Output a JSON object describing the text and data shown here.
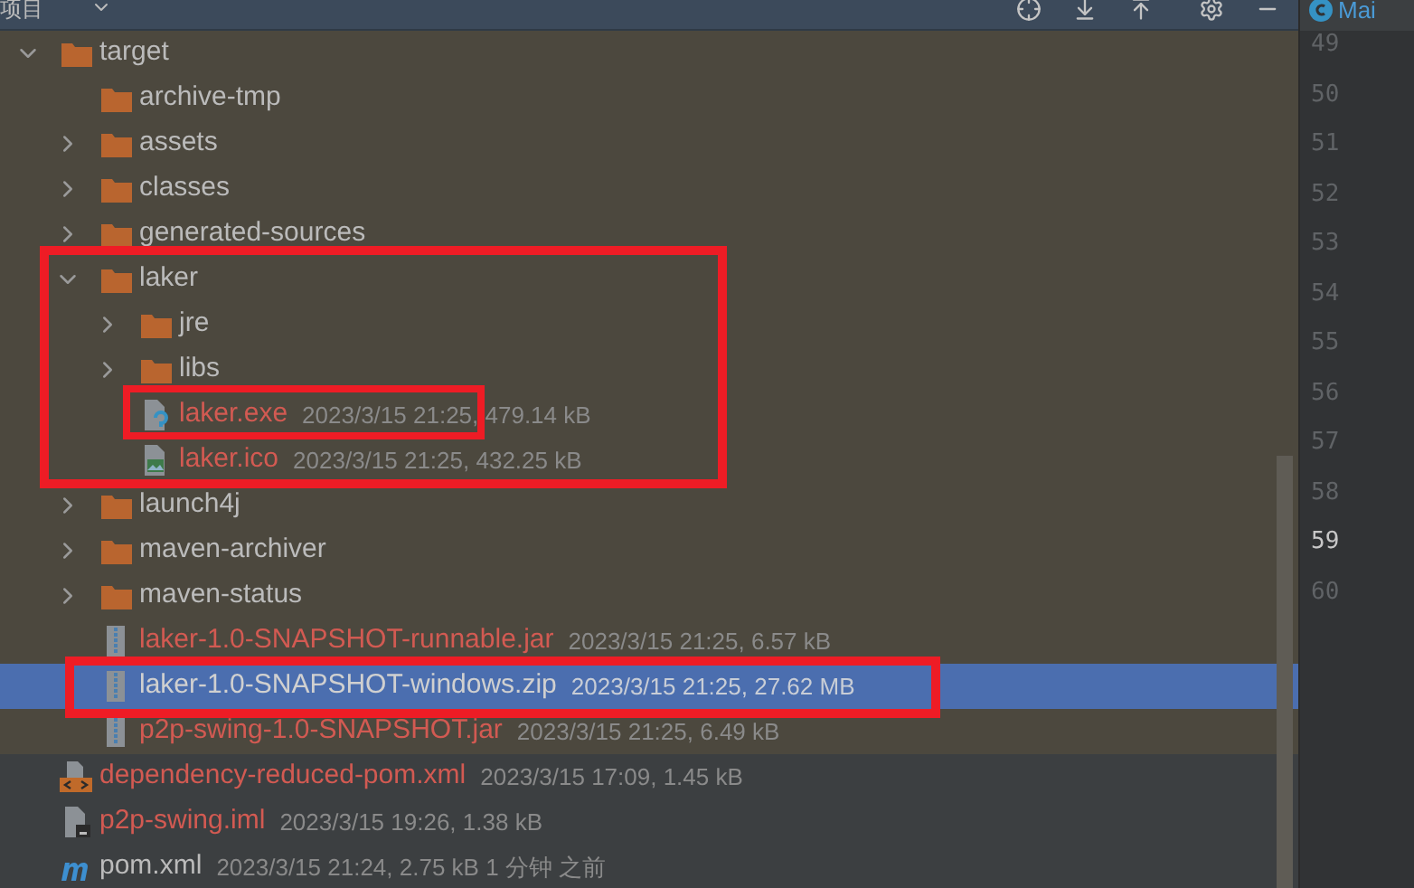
{
  "panel": {
    "title": "项目"
  },
  "tree": [
    {
      "name": "target",
      "kind": "folder",
      "expanded": true,
      "excluded": true,
      "untracked": false,
      "selected": false,
      "children": [
        {
          "name": "archive-tmp",
          "kind": "empty_folder",
          "untracked": false,
          "selected": false
        },
        {
          "name": "assets",
          "kind": "folder",
          "expanded": false,
          "untracked": false,
          "selected": false
        },
        {
          "name": "classes",
          "kind": "folder",
          "expanded": false,
          "untracked": false,
          "selected": false
        },
        {
          "name": "generated-sources",
          "kind": "folder",
          "expanded": false,
          "untracked": false,
          "selected": false
        },
        {
          "name": "laker",
          "kind": "folder",
          "expanded": true,
          "untracked": false,
          "selected": false,
          "children": [
            {
              "name": "jre",
              "kind": "folder",
              "expanded": false,
              "untracked": false,
              "selected": false
            },
            {
              "name": "libs",
              "kind": "folder",
              "expanded": false,
              "untracked": false,
              "selected": false
            },
            {
              "name": "laker.exe",
              "meta": "2023/3/15 21:25, 479.14 kB",
              "kind": "exe",
              "untracked": true,
              "selected": false
            },
            {
              "name": "laker.ico",
              "meta": "2023/3/15 21:25, 432.25 kB",
              "kind": "image",
              "untracked": true,
              "selected": false
            }
          ]
        },
        {
          "name": "launch4j",
          "kind": "folder",
          "expanded": false,
          "untracked": false,
          "selected": false
        },
        {
          "name": "maven-archiver",
          "kind": "folder",
          "expanded": false,
          "untracked": false,
          "selected": false
        },
        {
          "name": "maven-status",
          "kind": "folder",
          "expanded": false,
          "untracked": false,
          "selected": false
        },
        {
          "name": "laker-1.0-SNAPSHOT-runnable.jar",
          "meta": "2023/3/15 21:25, 6.57 kB",
          "kind": "archive",
          "untracked": true,
          "selected": false
        },
        {
          "name": "laker-1.0-SNAPSHOT-windows.zip",
          "meta": "2023/3/15 21:25, 27.62 MB",
          "kind": "archive",
          "untracked": false,
          "selected": true
        },
        {
          "name": "p2p-swing-1.0-SNAPSHOT.jar",
          "meta": "2023/3/15 21:25, 6.49 kB",
          "kind": "archive",
          "untracked": true,
          "selected": false
        }
      ]
    },
    {
      "name": "dependency-reduced-pom.xml",
      "meta": "2023/3/15 17:09, 1.45 kB",
      "kind": "xml",
      "excluded": false,
      "untracked": true,
      "selected": false
    },
    {
      "name": "p2p-swing.iml",
      "meta": "2023/3/15 19:26, 1.38 kB",
      "kind": "module",
      "excluded": false,
      "untracked": true,
      "selected": false
    },
    {
      "name": "pom.xml",
      "meta": "2023/3/15 21:24, 2.75 kB 1 分钟 之前",
      "kind": "maven",
      "excluded": false,
      "untracked": false,
      "selected": false
    }
  ],
  "editor": {
    "tab": "Mai",
    "line_numbers": [
      {
        "text": "49",
        "current": false
      },
      {
        "text": "50",
        "current": false
      },
      {
        "text": "51",
        "current": false
      },
      {
        "text": "52",
        "current": false
      },
      {
        "text": "53",
        "current": false
      },
      {
        "text": "54",
        "current": false
      },
      {
        "text": "55",
        "current": false
      },
      {
        "text": "56",
        "current": false
      },
      {
        "text": "57",
        "current": false
      },
      {
        "text": "58",
        "current": false
      },
      {
        "text": "59",
        "current": true
      },
      {
        "text": "60",
        "current": false
      }
    ]
  }
}
